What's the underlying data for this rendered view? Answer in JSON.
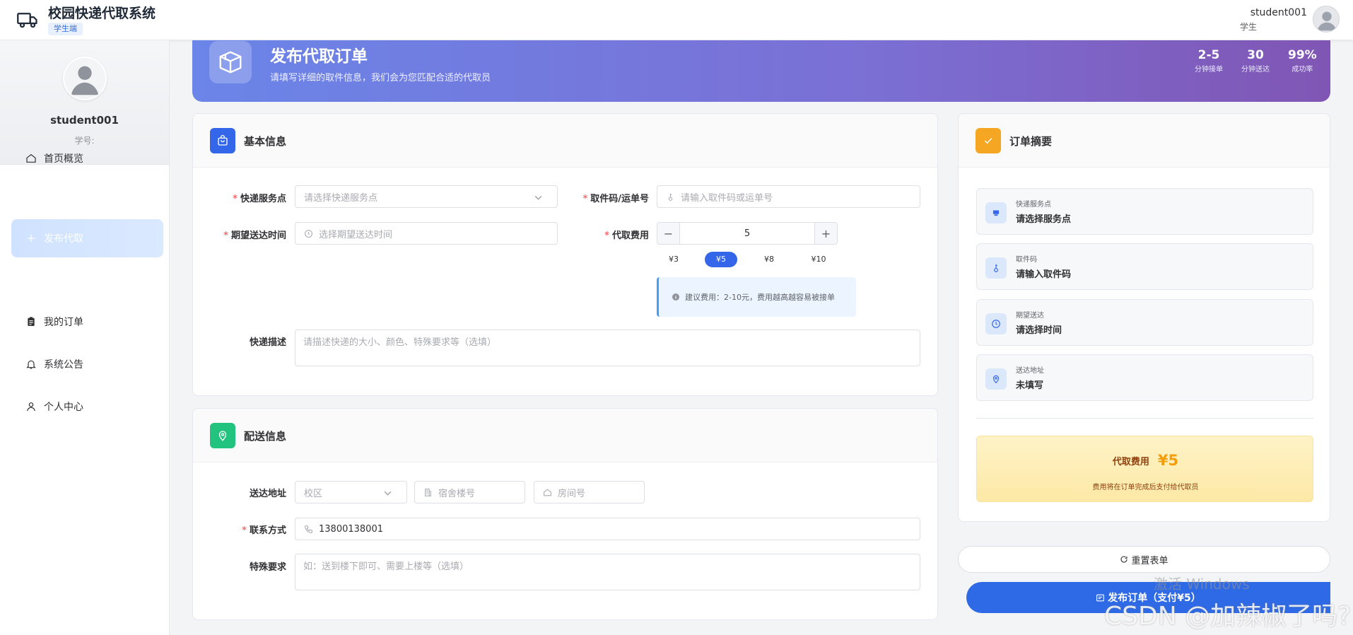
{
  "header": {
    "app_title": "校园快递代取系统",
    "role_tag": "学生端",
    "user_name": "student001",
    "user_role": "学生"
  },
  "sidebar": {
    "profile_name": "student001",
    "profile_id_label": "学号:",
    "items": [
      {
        "label": "首页概览",
        "icon": "home-icon"
      },
      {
        "label": "发布代取",
        "icon": "plus-icon",
        "active": true
      },
      {
        "label": "我的订单",
        "icon": "clipboard-icon"
      },
      {
        "label": "系统公告",
        "icon": "bell-icon"
      },
      {
        "label": "个人中心",
        "icon": "user-icon"
      }
    ]
  },
  "banner": {
    "title": "发布代取订单",
    "subtitle": "请填写详细的取件信息，我们会为您匹配合适的代取员",
    "stats": [
      {
        "value": "2-5",
        "label": "分钟接单"
      },
      {
        "value": "30",
        "label": "分钟送达"
      },
      {
        "value": "99%",
        "label": "成功率"
      }
    ]
  },
  "basic_info": {
    "title": "基本信息",
    "service_point_label": "快递服务点",
    "service_point_placeholder": "请选择快递服务点",
    "pickup_code_label": "取件码/运单号",
    "pickup_code_placeholder": "请输入取件码或运单号",
    "delivery_time_label": "期望送达时间",
    "delivery_time_placeholder": "选择期望送达时间",
    "fee_label": "代取费用",
    "fee_value": "5",
    "fee_minus": "−",
    "fee_plus": "+",
    "fee_presets": [
      "¥3",
      "¥5",
      "¥8",
      "¥10"
    ],
    "fee_selected": "¥5",
    "fee_tip": "建议费用：2-10元，费用越高越容易被接单",
    "description_label": "快递描述",
    "description_placeholder": "请描述快递的大小、颜色、特殊要求等（选填）"
  },
  "delivery_info": {
    "title": "配送信息",
    "address_label": "送达地址",
    "campus_placeholder": "校区",
    "building_placeholder": "宿舍楼号",
    "room_placeholder": "房间号",
    "contact_label": "联系方式",
    "contact_value": "13800138001",
    "special_label": "特殊要求",
    "special_placeholder": "如：送到楼下即可、需要上楼等（选填）"
  },
  "summary": {
    "title": "订单摘要",
    "items": [
      {
        "label": "快递服务点",
        "value": "请选择服务点"
      },
      {
        "label": "取件码",
        "value": "请输入取件码"
      },
      {
        "label": "期望送达",
        "value": "请选择时间"
      },
      {
        "label": "送达地址",
        "value": "未填写"
      }
    ],
    "fee_label": "代取费用",
    "fee_value": "¥5",
    "fee_note": "费用将在订单完成后支付给代取员"
  },
  "actions": {
    "reset_label": "重置表单",
    "submit_label": "发布订单（支付¥5）"
  },
  "watermarks": {
    "windows": "激活 Windows",
    "csdn": "CSDN @加辣椒了吗?"
  },
  "colors": {
    "primary": "#3366e8",
    "required": "#f56c6c",
    "banner_start": "#6b85e8",
    "banner_end": "#8056b4",
    "fee_amount": "#f59e0b",
    "delivery_icon": "#22c37e",
    "summary_icon": "#f5a623"
  }
}
